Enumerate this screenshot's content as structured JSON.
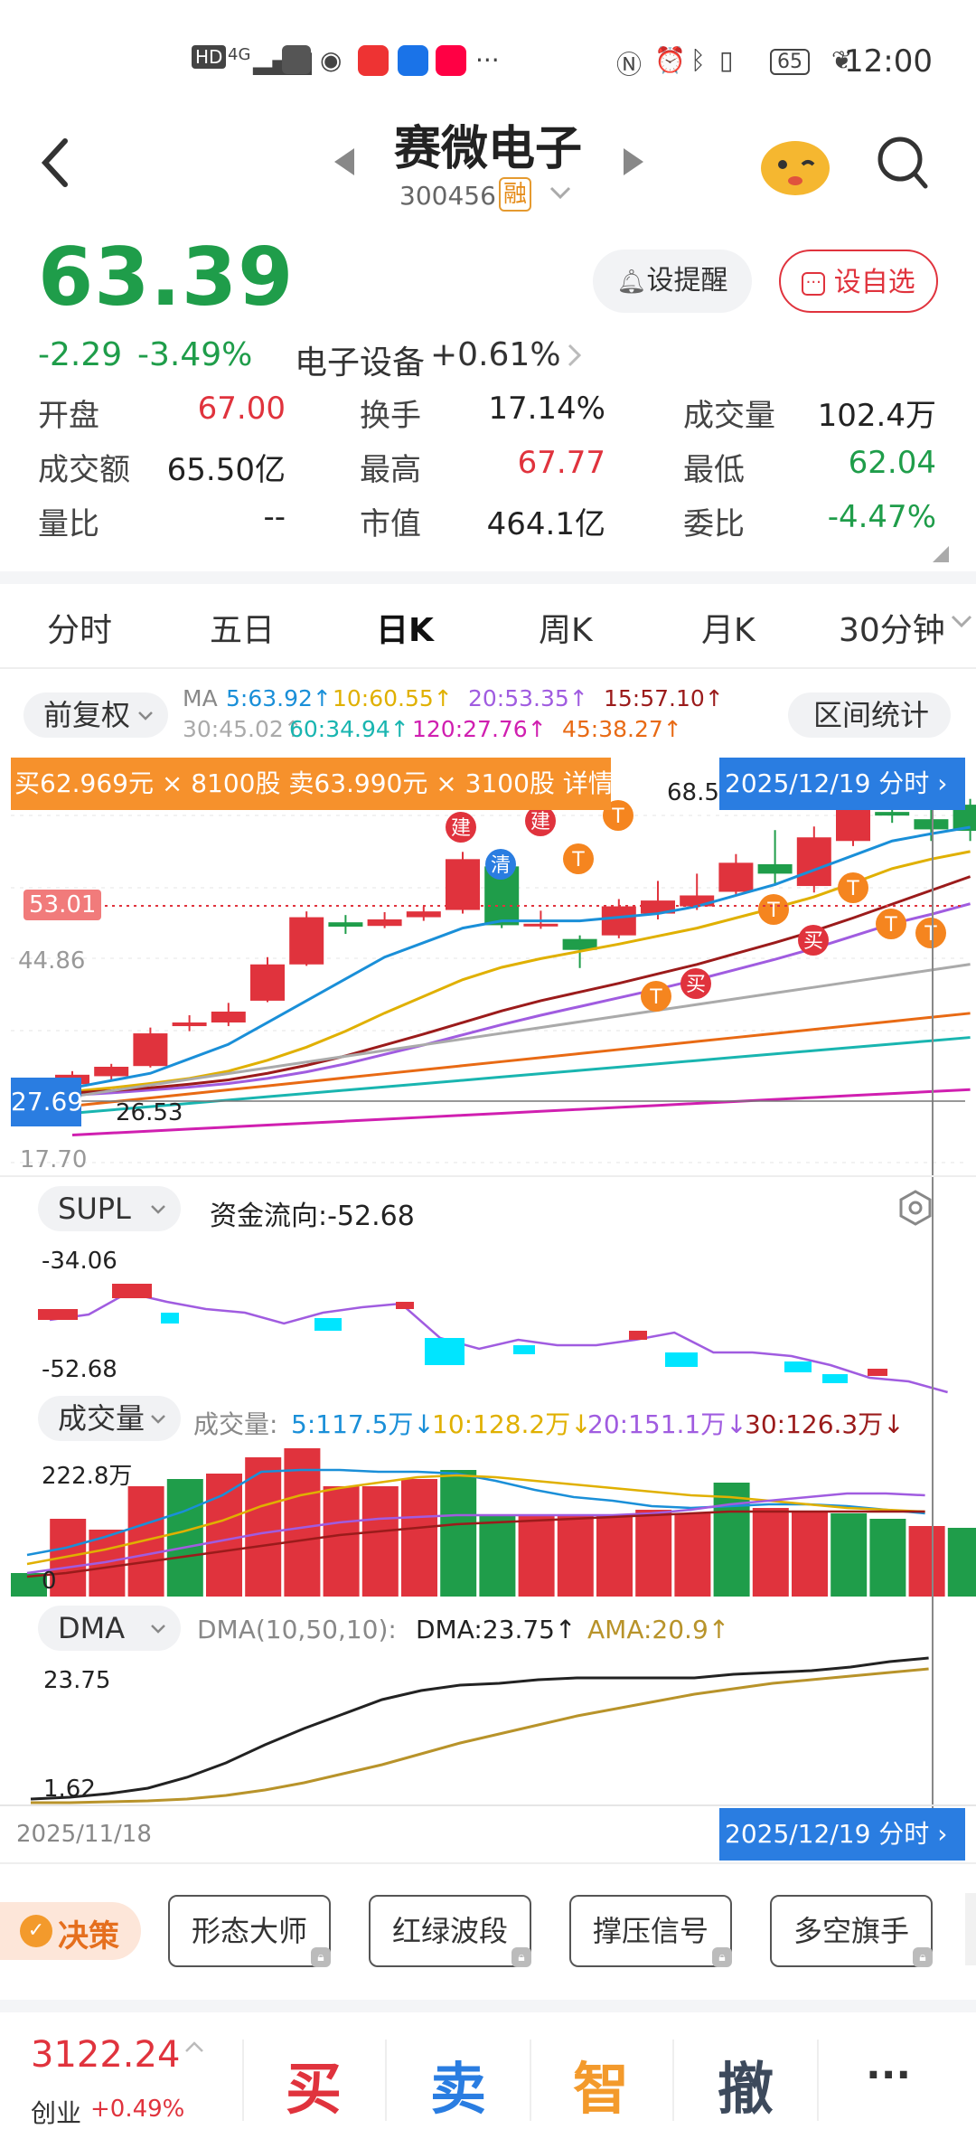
{
  "status_bar": {
    "left_icons": [
      "HD",
      "4G",
      "signal-icon",
      "message-icon",
      "browser-icon",
      "app-icon-1",
      "lightbulb-icon",
      "app-icon-2",
      "···"
    ],
    "battery": "65",
    "time": "12:00"
  },
  "header": {
    "title": "赛微电子",
    "code": "300456",
    "badge": "融"
  },
  "quote": {
    "price": "63.39",
    "change": "-2.29",
    "change_pct": "-3.49%",
    "sector": "电子设备",
    "sector_pct": "+0.61%",
    "alert_button": "设提醒",
    "watch_button": "设自选",
    "rows": [
      [
        {
          "label": "开盘",
          "value": "67.00",
          "color": "red"
        },
        {
          "label": "换手",
          "value": "17.14%",
          "color": "dark"
        },
        {
          "label": "成交量",
          "value": "102.4万",
          "color": "dark"
        }
      ],
      [
        {
          "label": "成交额",
          "value": "65.50亿",
          "color": "dark"
        },
        {
          "label": "最高",
          "value": "67.77",
          "color": "red"
        },
        {
          "label": "最低",
          "value": "62.04",
          "color": "green"
        }
      ],
      [
        {
          "label": "量比",
          "value": "--",
          "color": "dark"
        },
        {
          "label": "市值",
          "value": "464.1亿",
          "color": "dark"
        },
        {
          "label": "委比",
          "value": "-4.47%",
          "color": "green"
        }
      ]
    ]
  },
  "tabs": [
    "分时",
    "五日",
    "日K",
    "周K",
    "月K",
    "30分钟"
  ],
  "active_tab": "日K",
  "kline": {
    "adjust_button": "前复权",
    "range_button": "区间统计",
    "ma_prefix": "MA",
    "ma_items": [
      {
        "text": "5:63.92↑",
        "color": "#1a8fd8"
      },
      {
        "text": "10:60.55↑",
        "color": "#e0b000"
      },
      {
        "text": "20:53.35↑",
        "color": "#a05ce0"
      },
      {
        "text": "15:57.10↑",
        "color": "#9b1b1b"
      },
      {
        "text": "30:45.02↑",
        "color": "#aaaaaa"
      },
      {
        "text": "60:34.94↑",
        "color": "#19b5b0"
      },
      {
        "text": "120:27.76↑",
        "color": "#d01fb0"
      },
      {
        "text": "45:38.27↑",
        "color": "#e86a14"
      }
    ],
    "order_banner": "买62.969元 × 8100股 卖63.990元 × 3100股 详情",
    "date_tag": "2025/12/19",
    "date_tag_suffix": "分时",
    "price_marker": "53.01",
    "level_44": "44.86",
    "level_27": "27.69",
    "level_26": "26.53",
    "level_17": "17.70",
    "peak": "68.50",
    "signal_labels": {
      "jian": "建",
      "qing": "清",
      "t": "T",
      "mai": "买"
    }
  },
  "supl": {
    "button": "SUPL",
    "flow_label": "资金流向:-52.68",
    "top": "-34.06",
    "bottom": "-52.68"
  },
  "volume": {
    "button": "成交量",
    "prefix": "成交量:",
    "items": [
      {
        "text": "5:117.5万↓",
        "color": "#1a8fd8"
      },
      {
        "text": "10:128.2万↓",
        "color": "#e0b000"
      },
      {
        "text": "20:151.1万↓",
        "color": "#a05ce0"
      },
      {
        "text": "30:126.3万↓",
        "color": "#9b1b1b"
      }
    ],
    "max": "222.8万",
    "zero": "0"
  },
  "dma": {
    "button": "DMA",
    "params": "DMA(10,50,10):",
    "dma_val": "DMA:23.75↑",
    "ama_val": "AMA:20.9↑",
    "top": "23.75",
    "bottom": "1.62",
    "start_date": "2025/11/18"
  },
  "tools": {
    "decision": "决策",
    "buttons": [
      "形态大师",
      "红绿波段",
      "撑压信号",
      "多空旗手"
    ]
  },
  "bottom": {
    "index_value": "3122.24",
    "index_name": "创业",
    "index_pct": "+0.49%",
    "buy": "买",
    "sell": "卖",
    "smart": "智",
    "cancel": "撤",
    "more": "···"
  },
  "colors": {
    "up": "#e0333d",
    "down": "#1f9d4a",
    "accent_orange": "#f39a2c",
    "accent_blue": "#2a7de1"
  }
}
